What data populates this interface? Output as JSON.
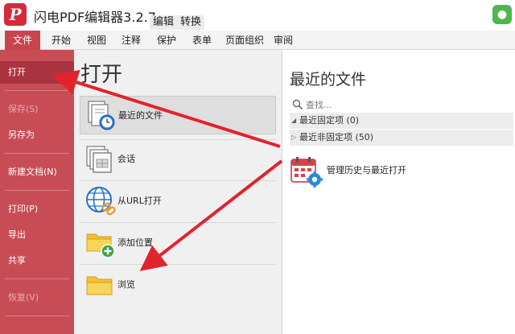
{
  "titlebar": {
    "logo_letter": "P",
    "title": "闪电PDF编辑器3.2.7",
    "context_tabs": [
      "编辑",
      "转换"
    ]
  },
  "ribbon": {
    "tabs": [
      {
        "label": "文件",
        "active": true
      },
      {
        "label": "开始"
      },
      {
        "label": "视图"
      },
      {
        "label": "注释"
      },
      {
        "label": "保护"
      },
      {
        "label": "表单"
      },
      {
        "label": "页面组织"
      },
      {
        "label": "审阅"
      }
    ]
  },
  "nav": {
    "items": [
      {
        "label": "打开",
        "state": "active"
      },
      {
        "label": "保存(S)",
        "state": "disabled"
      },
      {
        "label": "另存为",
        "state": "normal"
      },
      {
        "label": "新建文档(N)",
        "state": "normal"
      },
      {
        "label": "打印(P)",
        "state": "normal"
      },
      {
        "label": "导出",
        "state": "normal"
      },
      {
        "label": "共享",
        "state": "normal"
      },
      {
        "label": "恢复(V)",
        "state": "disabled"
      }
    ]
  },
  "open_panel": {
    "title": "打开",
    "options": [
      {
        "label": "最近的文件",
        "icon": "recent-files-clock-icon",
        "active": true
      },
      {
        "label": "会话",
        "icon": "session-icon"
      },
      {
        "label": "从URL打开",
        "icon": "globe-link-icon"
      },
      {
        "label": "添加位置",
        "icon": "folder-add-icon"
      },
      {
        "label": "浏览",
        "icon": "folder-icon"
      }
    ]
  },
  "recent_panel": {
    "title": "最近的文件",
    "search_placeholder": "查找...",
    "groups": [
      {
        "label": "最近固定项 (0)",
        "expanded": true
      },
      {
        "label": "最近非固定项 (50)",
        "expanded": false
      }
    ],
    "manage_label": "管理历史与最近打开"
  },
  "colors": {
    "accent": "#c84c56",
    "accent_dark": "#a93440",
    "arrow": "#e0242e"
  }
}
